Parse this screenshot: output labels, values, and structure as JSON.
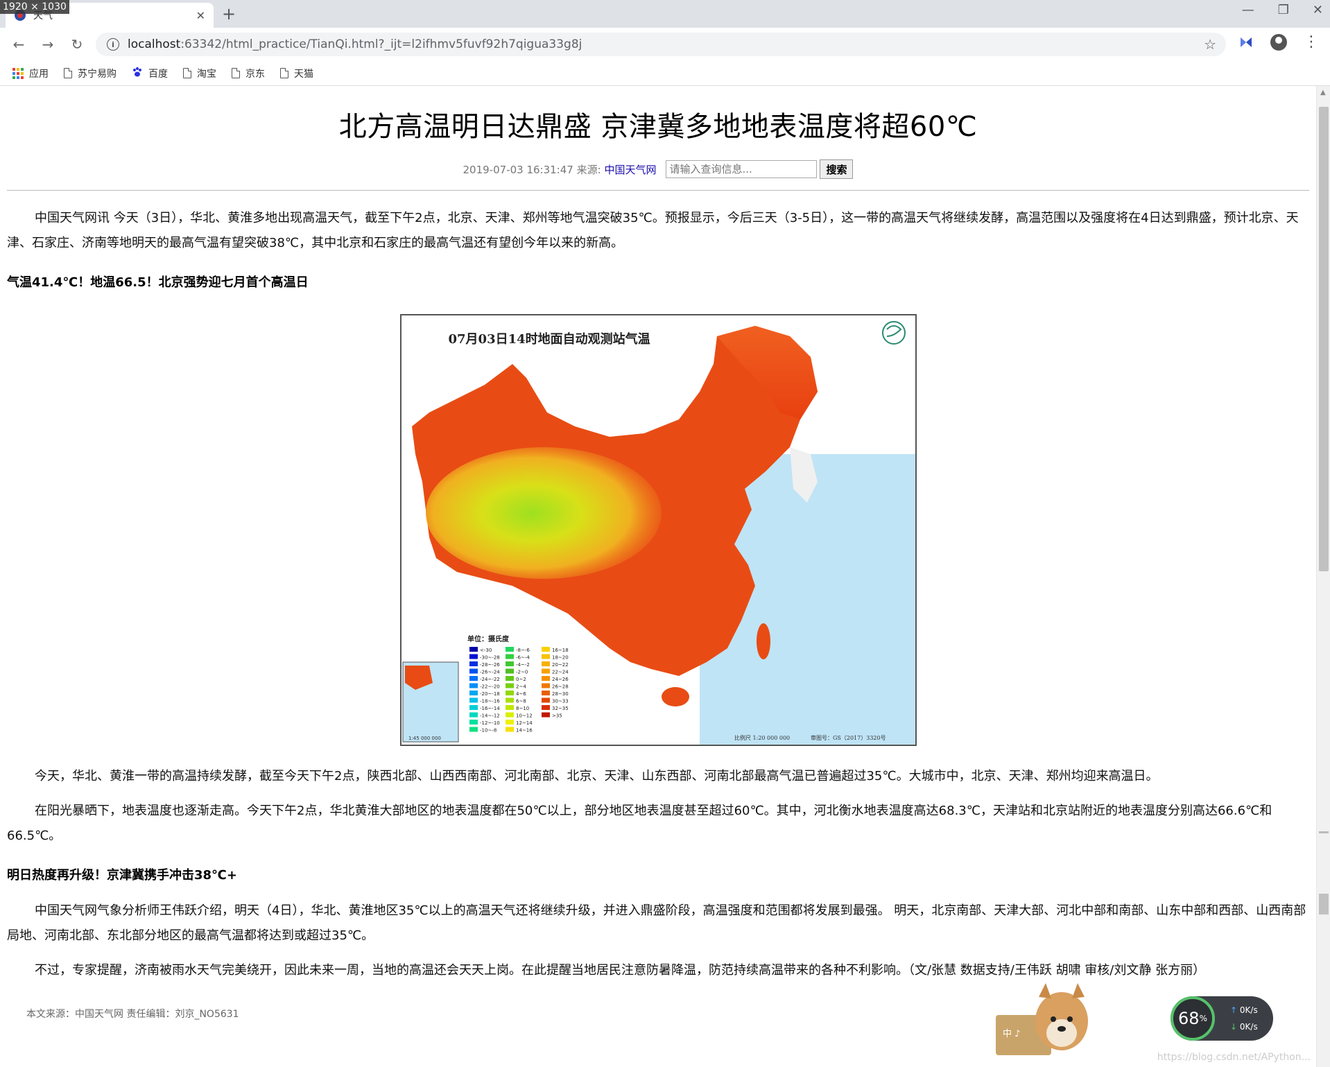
{
  "browser": {
    "screen_size_badge": "1920 × 1030",
    "tab_title": "天气",
    "url_host": "localhost",
    "url_rest": ":63342/html_practice/TianQi.html?_ijt=l2ifhmv5fuvf92h7qigua33g8j",
    "bookmarks": [
      "应用",
      "苏宁易购",
      "百度",
      "淘宝",
      "京东",
      "天猫"
    ]
  },
  "article": {
    "title": "北方高温明日达鼎盛 京津冀多地地表温度将超60℃",
    "date": "2019-07-03 16:31:47",
    "source_label": "来源:",
    "source_name": "中国天气网",
    "search_placeholder": "请输入查询信息...",
    "search_button": "搜索",
    "paragraphs": [
      "中国天气网讯 今天（3日），华北、黄淮多地出现高温天气，截至下午2点，北京、天津、郑州等地气温突破35℃。预报显示，今后三天（3-5日），这一带的高温天气将继续发酵，高温范围以及强度将在4日达到鼎盛，预计北京、天津、石家庄、济南等地明天的最高气温有望突破38℃，其中北京和石家庄的最高气温还有望创今年以来的新高。",
      "今天，华北、黄淮一带的高温持续发酵，截至今天下午2点，陕西北部、山西西南部、河北南部、北京、天津、山东西部、河南北部最高气温已普遍超过35℃。大城市中，北京、天津、郑州均迎来高温日。",
      "在阳光暴晒下，地表温度也逐渐走高。今天下午2点，华北黄淮大部地区的地表温度都在50℃以上，部分地区地表温度甚至超过60℃。其中，河北衡水地表温度高达68.3℃，天津站和北京站附近的地表温度分别高达66.6℃和66.5℃。",
      "中国天气网气象分析师王伟跃介绍，明天（4日），华北、黄淮地区35℃以上的高温天气还将继续升级，并进入鼎盛阶段，高温强度和范围都将发展到最强。 明天，北京南部、天津大部、河北中部和南部、山东中部和西部、山西南部局地、河南北部、东北部分地区的最高气温都将达到或超过35℃。",
      "不过，专家提醒，济南被雨水天气完美绕开，因此未来一周，当地的高温还会天天上岗。在此提醒当地居民注意防暑降温，防范持续高温带来的各种不利影响。（文/张慧 数据支持/王伟跃 胡啸 审核/刘文静 张方丽）"
    ],
    "subheads": [
      "气温41.4℃！地温66.5！北京强势迎七月首个高温日",
      "明日热度再升级！京津冀携手冲击38℃+"
    ],
    "map": {
      "title": "07月03日14时地面自动观测站气温",
      "legend_title": "单位：摄氏度",
      "legend": [
        {
          "label": "<-30",
          "color": "#0000a8"
        },
        {
          "label": "-30~-28",
          "color": "#0010d0"
        },
        {
          "label": "-28~-26",
          "color": "#0030e0"
        },
        {
          "label": "-26~-24",
          "color": "#0050f0"
        },
        {
          "label": "-24~-22",
          "color": "#0070f8"
        },
        {
          "label": "-22~-20",
          "color": "#0090f8"
        },
        {
          "label": "-20~-18",
          "color": "#00a8f0"
        },
        {
          "label": "-18~-16",
          "color": "#00c0e8"
        },
        {
          "label": "-16~-14",
          "color": "#00d0d8"
        },
        {
          "label": "-14~-12",
          "color": "#00d8c0"
        },
        {
          "label": "-12~-10",
          "color": "#00e0a0"
        },
        {
          "label": "-10~-8",
          "color": "#10e080"
        },
        {
          "label": "-8~-6",
          "color": "#20d860"
        },
        {
          "label": "-6~-4",
          "color": "#30d040"
        },
        {
          "label": "-4~-2",
          "color": "#40c830"
        },
        {
          "label": "-2~0",
          "color": "#50c020"
        },
        {
          "label": "0~2",
          "color": "#60c818"
        },
        {
          "label": "2~4",
          "color": "#78d010"
        },
        {
          "label": "4~6",
          "color": "#90d808"
        },
        {
          "label": "6~8",
          "color": "#a8e000"
        },
        {
          "label": "8~10",
          "color": "#c0e800"
        },
        {
          "label": "10~12",
          "color": "#d8f000"
        },
        {
          "label": "12~14",
          "color": "#f0f000"
        },
        {
          "label": "14~16",
          "color": "#f8e000"
        },
        {
          "label": "16~18",
          "color": "#f8d000"
        },
        {
          "label": "18~20",
          "color": "#f8c000"
        },
        {
          "label": "20~22",
          "color": "#f8b000"
        },
        {
          "label": "22~24",
          "color": "#f8a000"
        },
        {
          "label": "24~26",
          "color": "#f89000"
        },
        {
          "label": "26~28",
          "color": "#f07800"
        },
        {
          "label": "28~30",
          "color": "#e86000"
        },
        {
          "label": "30~33",
          "color": "#e04800"
        },
        {
          "label": "32~35",
          "color": "#d83000"
        },
        {
          "label": ">35",
          "color": "#c01800"
        }
      ],
      "scale": "比例尺 1:20 000 000",
      "approval": "审图号：GS（2017）3320号",
      "inset_scale": "1:45 000 000"
    },
    "footer": "本文来源：中国天气网 责任编辑：刘京_NO5631"
  },
  "overlay": {
    "net_percent": "68",
    "net_percent_unit": "%",
    "up_speed": "0K/s",
    "down_speed": "0K/s",
    "dog_chars": "中 ♪",
    "watermark": "https://blog.csdn.net/APython..."
  }
}
